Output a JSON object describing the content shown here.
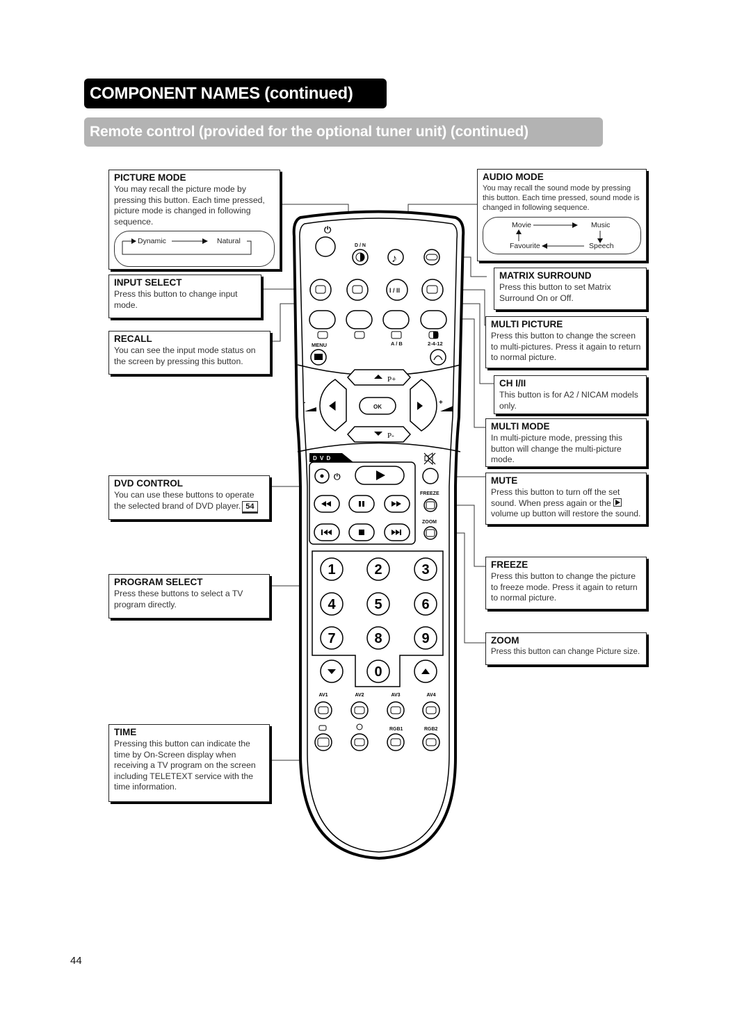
{
  "header": {
    "title": "COMPONENT NAMES (continued)",
    "subtitle": "Remote control (provided for the optional tuner unit) (continued)"
  },
  "callouts": {
    "picture_mode": {
      "title": "PICTURE MODE",
      "text": "You may recall the picture mode by pressing this button. Each time pressed, picture mode is changed in following sequence.",
      "sequence": [
        "Dynamic",
        "Natural"
      ]
    },
    "audio_mode": {
      "title": "AUDIO MODE",
      "text": "You may recall the sound mode by pressing this button. Each time pressed, sound mode is changed in following sequence.",
      "sequence": [
        "Movie",
        "Music",
        "Speech",
        "Favourite"
      ]
    },
    "input_select": {
      "title": "INPUT SELECT",
      "text": "Press this button to change input mode."
    },
    "recall": {
      "title": "RECALL",
      "text": "You can see the input mode status on the screen by pressing this button."
    },
    "dvd_control": {
      "title": "DVD CONTROL",
      "text": "You can use these buttons to operate the selected brand of DVD player.",
      "page_ref": "54"
    },
    "program_select": {
      "title": "PROGRAM SELECT",
      "text": "Press these buttons to select a TV program directly."
    },
    "time": {
      "title": "TIME",
      "text": "Pressing this button can indicate the time by On-Screen display when receiving a TV program on the screen including TELETEXT service with the time information."
    },
    "matrix_surround": {
      "title": "MATRIX SURROUND",
      "text": "Press this button to set Matrix Surround On or Off."
    },
    "multi_picture": {
      "title": "MULTI PICTURE",
      "text": "Press this button to change the screen to multi-pictures. Press it again to return to normal picture."
    },
    "ch": {
      "title": "CH I/II",
      "text": "This button is for A2 / NICAM models only."
    },
    "multi_mode": {
      "title": "MULTI MODE",
      "text": "In multi-picture mode, pressing this button will change the multi-picture mode."
    },
    "mute": {
      "title": "MUTE",
      "text_before": "Press this button to turn off the set sound. When press again or the",
      "text_after": "volume up button will restore the sound."
    },
    "freeze": {
      "title": "FREEZE",
      "text": "Press this button to change the picture to freeze mode. Press it again to return to normal picture."
    },
    "zoom": {
      "title": "ZOOM",
      "text": "Press this button can change Picture size."
    }
  },
  "remote": {
    "power_symbol": "⏻",
    "dn_label": "D / N",
    "ch_button": "I / II",
    "menu_label": "MENU",
    "ab_label": "A / B",
    "mp_label": "2-4-12",
    "p_plus": "P+",
    "p_minus": "P-",
    "ok_label": "OK",
    "vol_minus": "-",
    "vol_plus": "+",
    "dvd_label": "D V D",
    "freeze_label": "FREEZE",
    "zoom_label": "ZOOM",
    "digits": [
      "1",
      "2",
      "3",
      "4",
      "5",
      "6",
      "7",
      "8",
      "9",
      "0"
    ],
    "av_labels": [
      "AV1",
      "AV2",
      "AV3",
      "AV4"
    ],
    "rgb_labels": [
      "RGB1",
      "RGB2"
    ]
  },
  "page_number": "44"
}
